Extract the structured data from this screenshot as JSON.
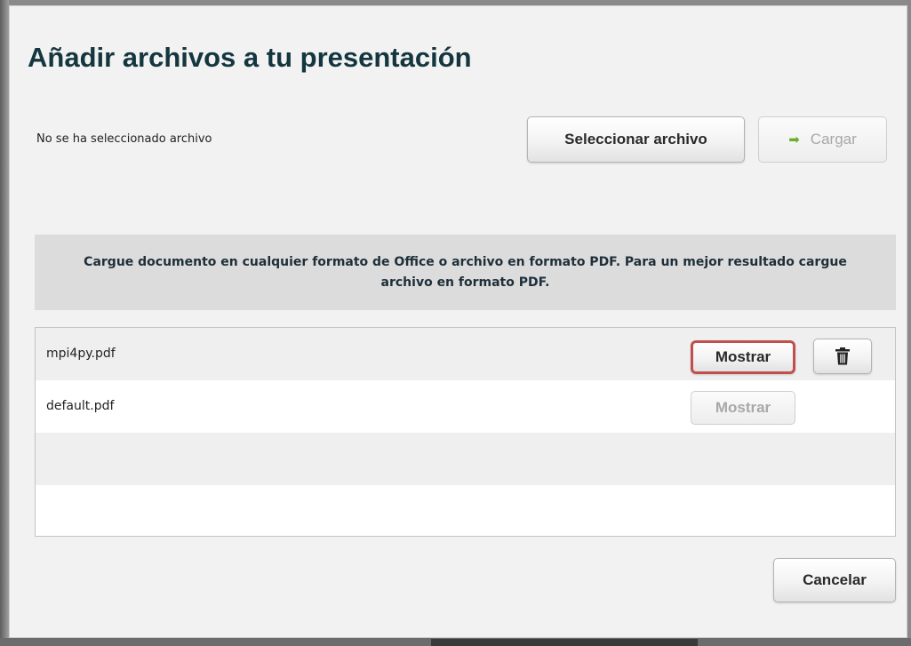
{
  "dialog": {
    "title": "Añadir archivos a tu presentación",
    "file_status": "No se ha seleccionado archivo",
    "select_file_label": "Seleccionar archivo",
    "upload_label": "Cargar",
    "info_text": "Cargue documento en cualquier formato de Office o archivo en formato PDF. Para un mejor resultado cargue archivo en formato PDF.",
    "files": [
      {
        "name": "mpi4py.pdf",
        "show_label": "Mostrar",
        "show_enabled": true,
        "highlighted": true,
        "deletable": true
      },
      {
        "name": "default.pdf",
        "show_label": "Mostrar",
        "show_enabled": false,
        "highlighted": false,
        "deletable": false
      }
    ],
    "cancel_label": "Cancelar"
  },
  "icons": {
    "upload": "arrow-right-icon",
    "delete": "trash-icon"
  },
  "colors": {
    "title": "#14363f",
    "highlight_border": "#c0504d",
    "upload_arrow": "#6cae2a",
    "info_background": "#dcdcdc"
  }
}
